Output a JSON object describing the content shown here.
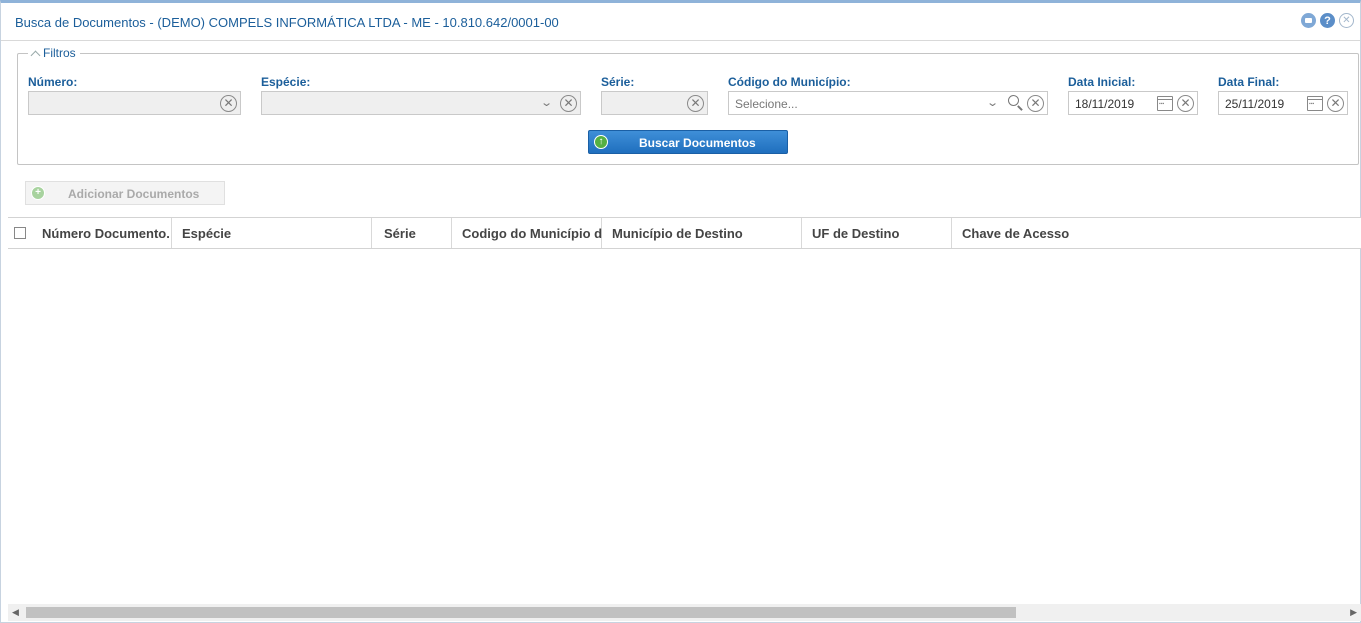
{
  "window": {
    "title": "Busca de Documentos - (DEMO) COMPELS INFORMÁTICA LTDA - ME - 10.810.642/0001-00",
    "help_label": "?",
    "close_label": "✕"
  },
  "filters": {
    "legend": "Filtros",
    "numero": {
      "label": "Número:",
      "value": ""
    },
    "especie": {
      "label": "Espécie:",
      "value": ""
    },
    "serie": {
      "label": "Série:",
      "value": ""
    },
    "codigo_municipio": {
      "label": "Código do Município:",
      "placeholder": "Selecione..."
    },
    "data_inicial": {
      "label": "Data Inicial:",
      "value": "18/11/2019"
    },
    "data_final": {
      "label": "Data Final:",
      "value": "25/11/2019"
    },
    "search_button": "Buscar Documentos"
  },
  "add_button": {
    "label": "Adicionar Documentos",
    "enabled": false
  },
  "grid": {
    "columns": [
      "Número Documento.",
      "Espécie",
      "Série",
      "Codigo do Município de Destino",
      "Município de Destino",
      "UF de Destino",
      "Chave de Acesso"
    ],
    "rows": []
  },
  "colors": {
    "title": "#1b5e9a",
    "primary_button": "#2a7cc9",
    "add_icon": "#55b043"
  }
}
